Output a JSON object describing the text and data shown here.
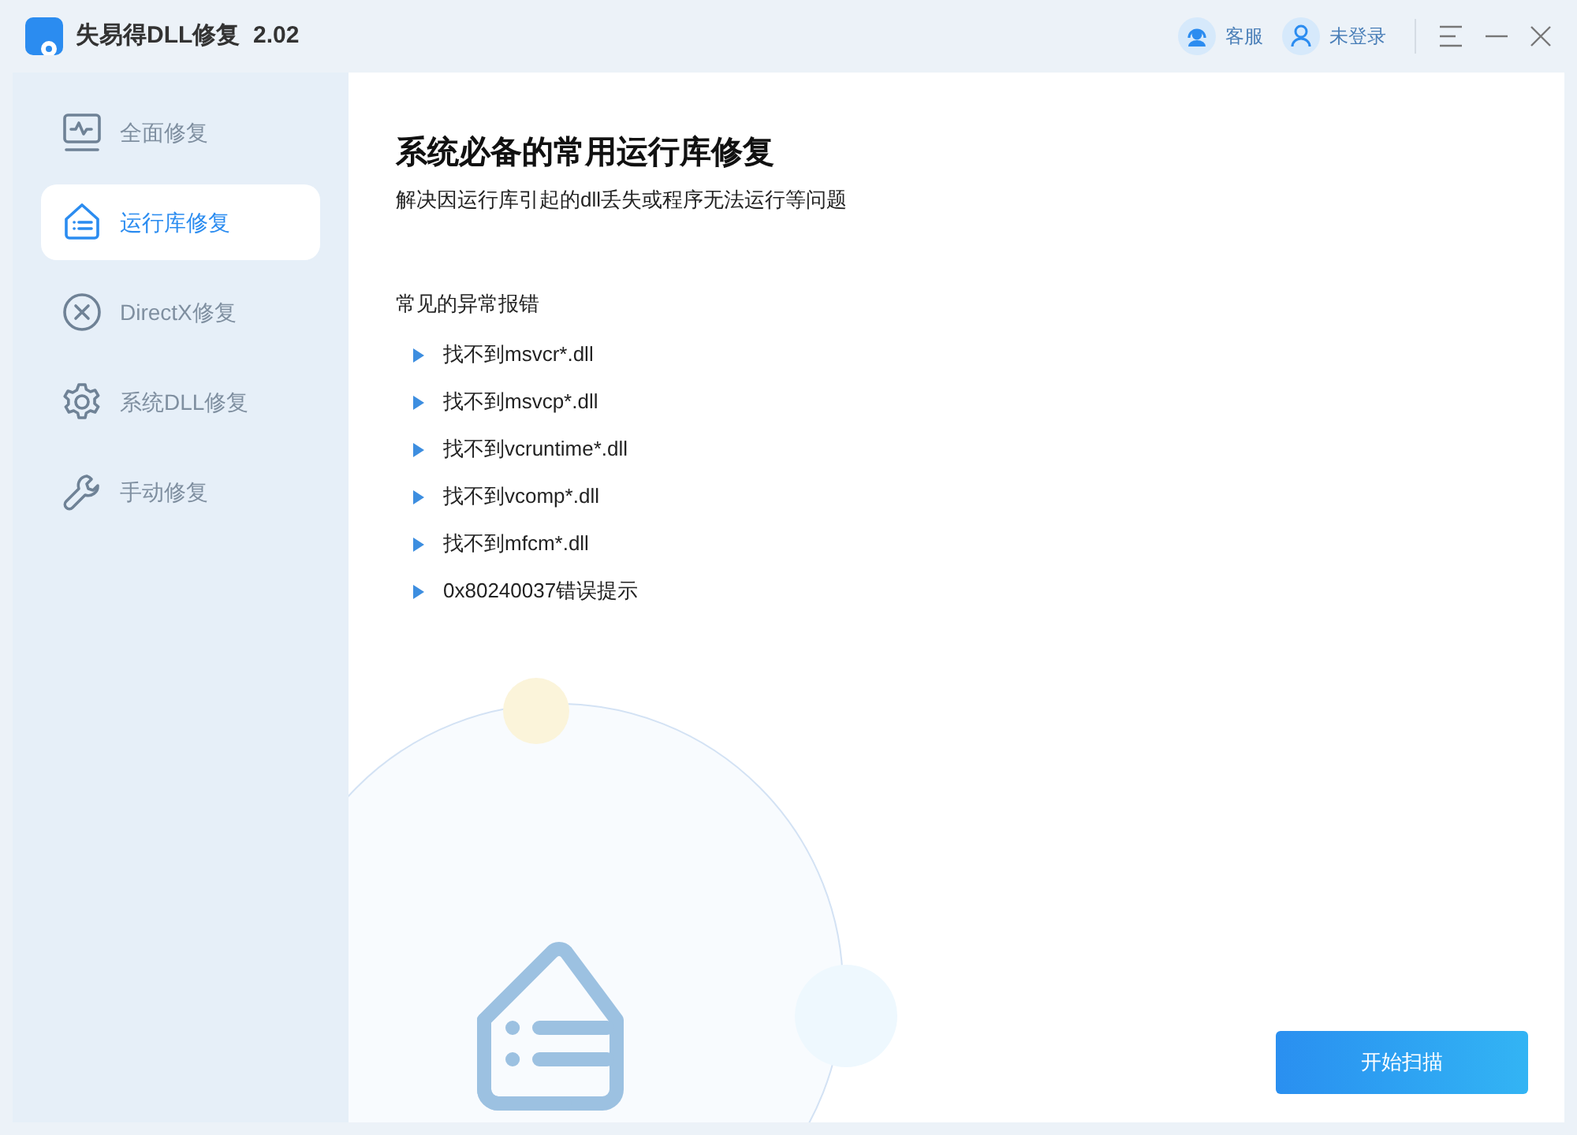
{
  "window": {
    "title": "失易得DLL修复  2.02"
  },
  "header_actions": [
    {
      "kind": "support",
      "label": "客服"
    },
    {
      "kind": "user",
      "label": "未登录"
    }
  ],
  "sidebar": {
    "items": [
      {
        "kind": "monitor",
        "label": "全面修复",
        "selected": false
      },
      {
        "kind": "house",
        "label": "运行库修复",
        "selected": true
      },
      {
        "kind": "x-circle",
        "label": "DirectX修复",
        "selected": false
      },
      {
        "kind": "gear",
        "label": "系统DLL修复",
        "selected": false
      },
      {
        "kind": "wrench",
        "label": "手动修复",
        "selected": false
      }
    ]
  },
  "main": {
    "title": "系统必备的常用运行库修复",
    "subtitle": "解决因运行库引起的dll丢失或程序无法运行等问题",
    "section_title": "常见的异常报错",
    "errors": [
      "找不到msvcr*.dll",
      "找不到msvcp*.dll",
      "找不到vcruntime*.dll",
      "找不到vcomp*.dll",
      "找不到mfcm*.dll",
      "0x80240037错误提示"
    ],
    "button": "开始扫描"
  }
}
